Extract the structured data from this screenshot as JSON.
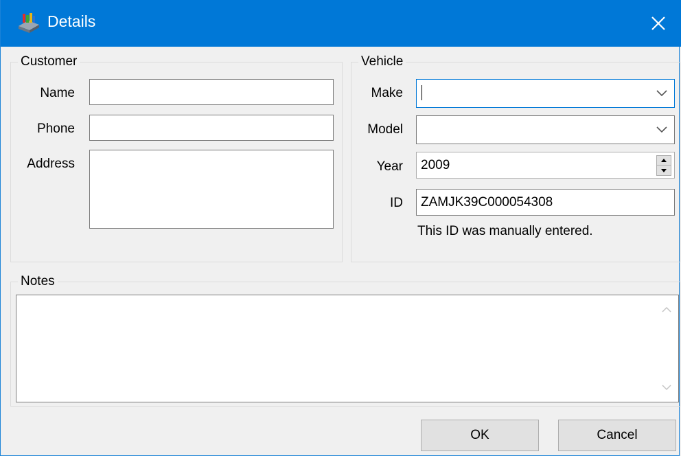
{
  "window": {
    "title": "Details",
    "app_icon": "app-icon",
    "close_icon": "close-icon"
  },
  "customer": {
    "legend": "Customer",
    "name_label": "Name",
    "name_value": "",
    "phone_label": "Phone",
    "phone_value": "",
    "address_label": "Address",
    "address_value": ""
  },
  "vehicle": {
    "legend": "Vehicle",
    "make_label": "Make",
    "make_value": "",
    "model_label": "Model",
    "model_value": "",
    "year_label": "Year",
    "year_value": "2009",
    "id_label": "ID",
    "id_value": "ZAMJK39C000054308",
    "id_note": "This ID was manually entered."
  },
  "notes": {
    "legend": "Notes",
    "value": ""
  },
  "buttons": {
    "ok_label": "OK",
    "cancel_label": "Cancel"
  },
  "colors": {
    "titlebar": "#0078d7",
    "focus_border": "#0078d7",
    "background": "#f0f0f0"
  }
}
